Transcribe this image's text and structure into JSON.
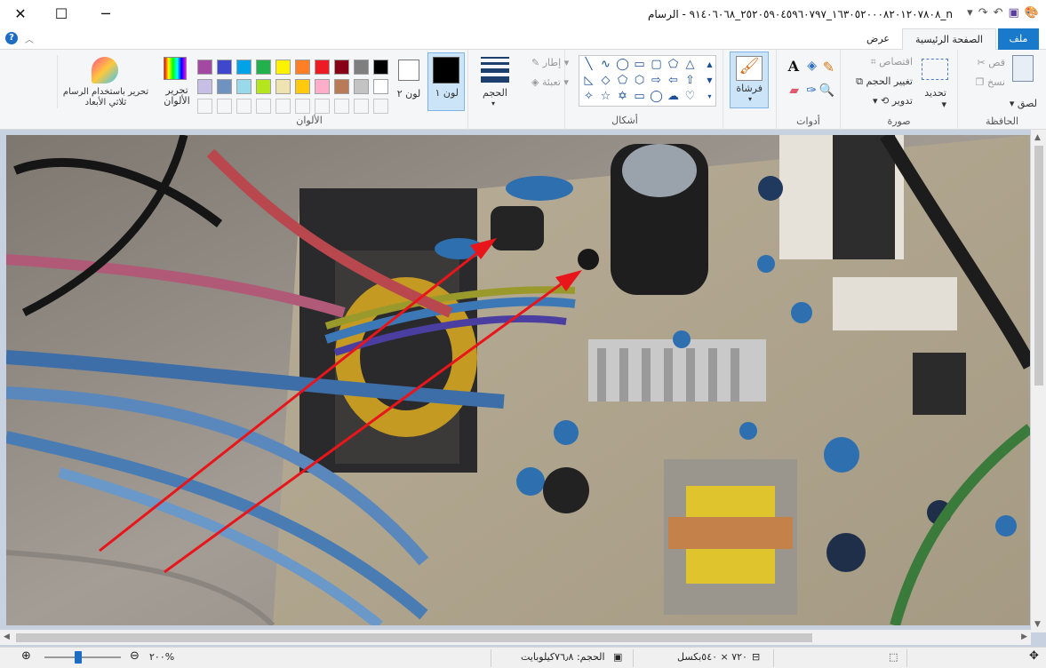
{
  "window": {
    "title": "n_١٦٣٠٥٢٠٠٠٨٢٠١٢٠٧٨٠٨_٢٥٢٠٥٩٠٤٥٩٦٠٧٩٧_٩١٤٠٦٠٦٨ - الرسام",
    "minimize": "─",
    "maximize": "☐",
    "close": "✕"
  },
  "tabs": {
    "file": "ملف",
    "home": "الصفحة الرئيسية",
    "view": "عرض"
  },
  "ribbon": {
    "clipboard": {
      "label": "الحافظة",
      "paste": "لصق",
      "cut": "قص",
      "copy": "نسخ"
    },
    "image": {
      "label": "صورة",
      "select": "تحديد",
      "crop": "اقتصاص",
      "resize": "تغيير الحجم",
      "rotate": "تدوير"
    },
    "tools": {
      "label": "أدوات"
    },
    "brushes": {
      "label": "فرشاة"
    },
    "shapes": {
      "label": "أشكال",
      "outline": "إطار",
      "fill": "تعبئة"
    },
    "size": {
      "label": "الحجم"
    },
    "colors": {
      "label": "الألوان",
      "color1": "لون ١",
      "color2": "لون ٢",
      "edit_colors": "تحرير الألوان",
      "paint3d": "تحرير باستخدام الرسام ثلاثي الأبعاد",
      "row1": [
        "#000000",
        "#7f7f7f",
        "#880015",
        "#ed1c24",
        "#ff7f27",
        "#fff200",
        "#22b14c",
        "#00a2e8",
        "#3f48cc",
        "#a349a4"
      ],
      "row2": [
        "#ffffff",
        "#c3c3c3",
        "#b97a57",
        "#ffaec9",
        "#ffc90e",
        "#efe4b0",
        "#b5e61d",
        "#99d9ea",
        "#7092be",
        "#c8bfe7"
      ]
    }
  },
  "status": {
    "dimensions": "٧٢٠ × ٥٤٠بكسل",
    "filesize": "الحجم: ٧٦٫٨كيلوبايت",
    "zoom": "٢٠٠%"
  }
}
